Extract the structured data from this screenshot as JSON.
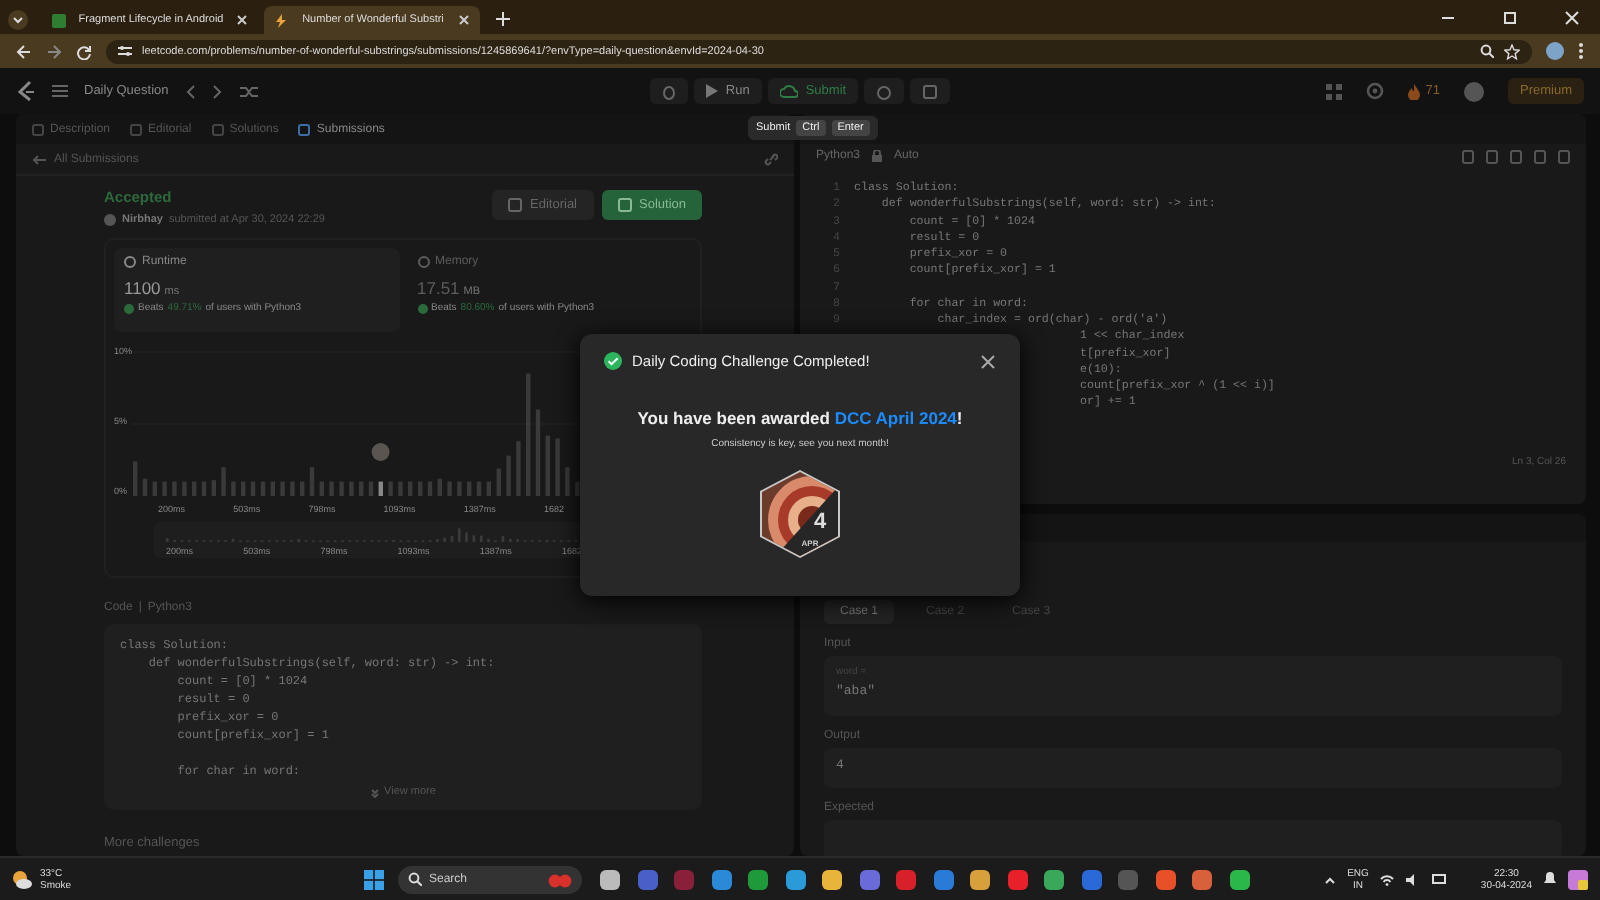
{
  "browser": {
    "tabs": [
      {
        "title": "Fragment Lifecycle in Android",
        "selected": false
      },
      {
        "title": "Number of Wonderful Substri",
        "selected": true
      }
    ],
    "url": "leetcode.com/problems/number-of-wonderful-substrings/submissions/1245869641/?envType=daily-question&envId=2024-04-30"
  },
  "header": {
    "title": "Daily Question",
    "run": "Run",
    "submit": "Submit",
    "streak": "71",
    "premium": "Premium"
  },
  "tooltip": {
    "label": "Submit",
    "keys": [
      "Ctrl",
      "Enter"
    ]
  },
  "panel_tabs": [
    {
      "label": "Description",
      "selected": false
    },
    {
      "label": "Editorial",
      "selected": false
    },
    {
      "label": "Solutions",
      "selected": false
    },
    {
      "label": "Submissions",
      "selected": true
    }
  ],
  "submission": {
    "back": "All Submissions",
    "status": "Accepted",
    "user": "Nirbhay",
    "submitted": "submitted at Apr 30, 2024 22:29",
    "buttons": [
      {
        "label": "Editorial",
        "kind": "secondary"
      },
      {
        "label": "Solution",
        "kind": "primary"
      }
    ],
    "stats": [
      {
        "title": "Runtime",
        "value": "1100",
        "unit": "ms",
        "beats": "Beats",
        "percent": "49.71%",
        "suffix": "of users with Python3",
        "selected": true
      },
      {
        "title": "Memory",
        "value": "17.51",
        "unit": "MB",
        "beats": "Beats",
        "percent": "80.60%",
        "suffix": "of users with Python3",
        "selected": false
      }
    ],
    "chart": {
      "yticks": [
        "10%",
        "5%",
        "0%"
      ],
      "xlabels": [
        "200ms",
        "503ms",
        "798ms",
        "1093ms",
        "1387ms",
        "1682"
      ],
      "overview_labels": [
        "200ms",
        "503ms",
        "798ms",
        "1093ms",
        "1387ms",
        "1682"
      ]
    },
    "code_title": "Code",
    "code_separator": "|",
    "code_lang": "Python3",
    "code": [
      {
        "kind": "line",
        "text": "class Solution:"
      },
      {
        "kind": "line",
        "text": "    def wonderfulSubstrings(self, word: str) -> int:"
      },
      {
        "kind": "line",
        "text": "        count = [0] * 1024"
      },
      {
        "kind": "line",
        "text": "        result = 0"
      },
      {
        "kind": "line",
        "text": "        prefix_xor = 0"
      },
      {
        "kind": "line",
        "text": "        count[prefix_xor] = 1"
      },
      {
        "kind": "blank"
      },
      {
        "kind": "line",
        "text": "        for char in word:"
      }
    ],
    "view_more": "View more",
    "more": "More challenges"
  },
  "editor": {
    "language": "Python3",
    "mode": "Auto",
    "lines": [
      {
        "kind": "full",
        "number": "1",
        "text": "class Solution:"
      },
      {
        "kind": "full",
        "number": "2",
        "text": "    def wonderfulSubstrings(self, word: str) -> int:"
      },
      {
        "kind": "full",
        "number": "3",
        "text": "        count = [0] * 1024"
      },
      {
        "kind": "full",
        "number": "4",
        "text": "        result = 0"
      },
      {
        "kind": "full",
        "number": "5",
        "text": "        prefix_xor = 0"
      },
      {
        "kind": "full",
        "number": "6",
        "text": "        count[prefix_xor] = 1"
      },
      {
        "kind": "full",
        "number": "7"
      },
      {
        "kind": "full",
        "number": "8",
        "text": "        for char in word:"
      },
      {
        "kind": "full",
        "number": "9",
        "text": "            char_index = ord(char) - ord('a')"
      },
      {
        "kind": "partial",
        "text": "1 << char_index"
      },
      {
        "kind": "partial",
        "text": "t[prefix_xor]"
      },
      {
        "kind": "partial",
        "text": "e(10):"
      },
      {
        "kind": "partial",
        "text": "count[prefix_xor ^ (1 << i)]"
      },
      {
        "kind": "partial",
        "text": "or] += 1"
      }
    ],
    "cursor": "Ln 3, Col 26"
  },
  "testcase": {
    "cases": [
      {
        "label": "Case 1",
        "selected": true
      },
      {
        "label": "Case 2",
        "selected": false
      },
      {
        "label": "Case 3",
        "selected": false
      }
    ],
    "input_label": "Input",
    "param": "word =",
    "input": "\"aba\"",
    "output_label": "Output",
    "output": "4",
    "expected_label": "Expected"
  },
  "modal": {
    "title": "Daily Coding Challenge Completed!",
    "message": "You have been awarded",
    "award": "DCC April 2024",
    "message_end": "!",
    "subtitle": "Consistency is key, see you next month!",
    "badge_day": "4",
    "badge_month": "APR"
  },
  "taskbar": {
    "temperature": "33°C",
    "weather": "Smoke",
    "search": "Search",
    "lang": "ENG",
    "region": "IN",
    "time": "22:30",
    "date": "30-04-2024"
  }
}
